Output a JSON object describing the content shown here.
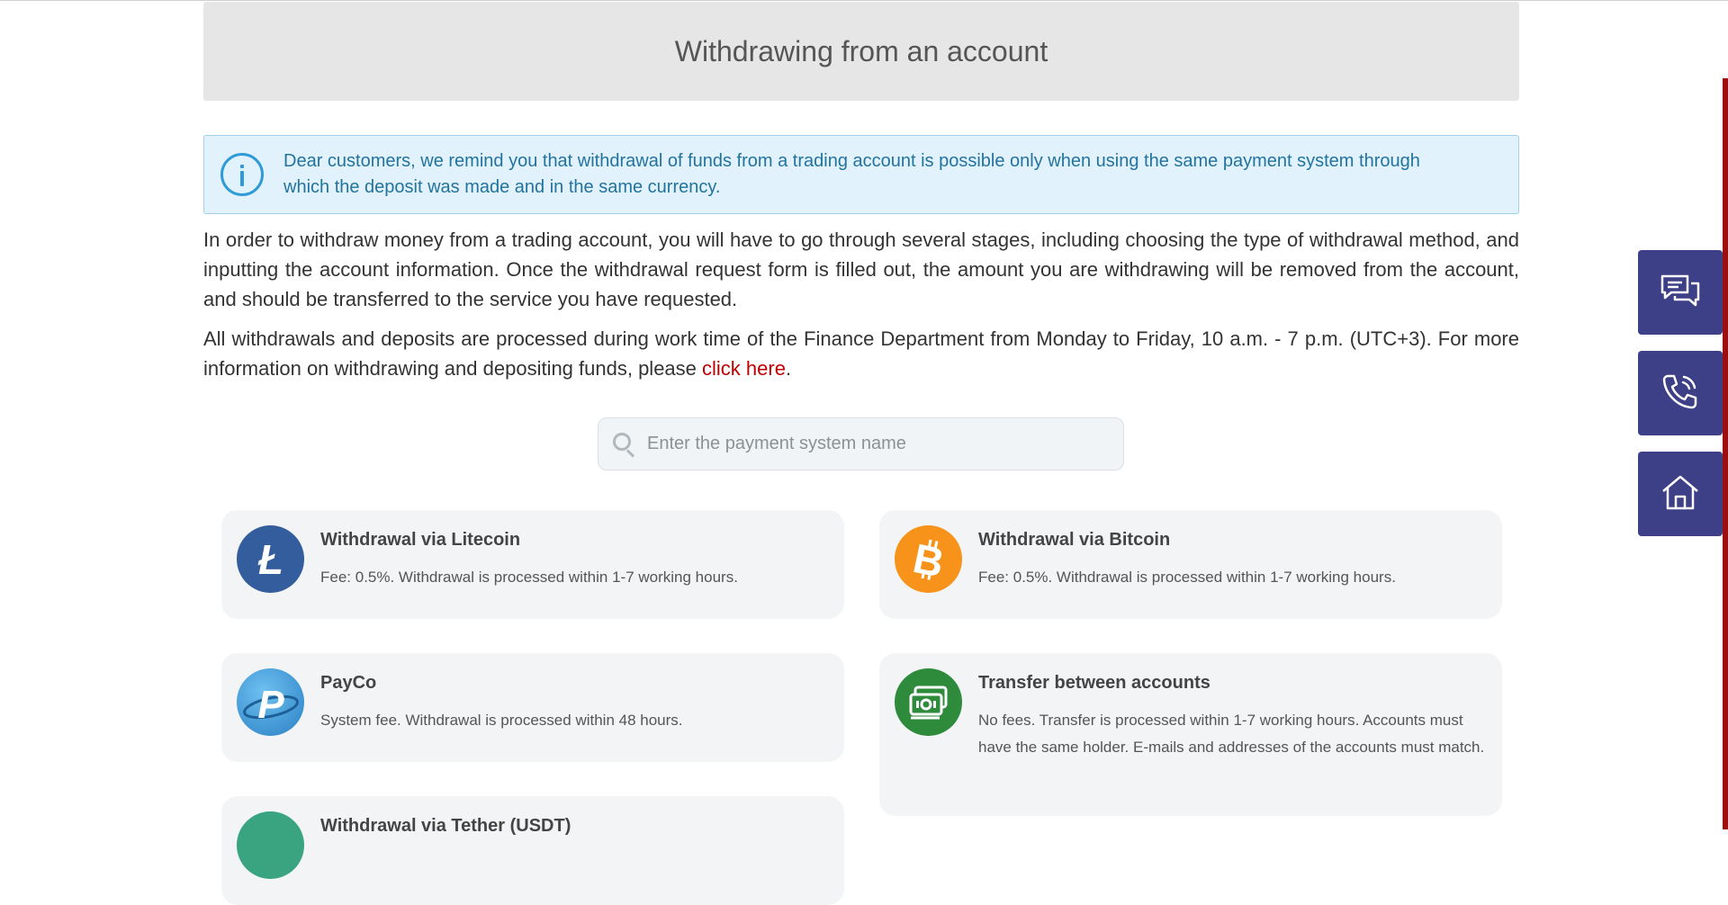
{
  "page_title": "Withdrawing from an account",
  "notice": "Dear customers, we remind you that withdrawal of funds from a trading account is possible only when using the same payment system through which the deposit was made and in the same currency.",
  "paragraph1": "In order to withdraw money from a trading account, you will have to go through several stages, including choosing the type of withdrawal method, and inputting the account information. Once the withdrawal request form is filled out, the amount you are withdrawing will be removed from the account, and should be transferred to the service you have requested.",
  "paragraph2": {
    "text": "All withdrawals and deposits are processed during work time of the Finance Department from Monday to Friday, 10 a.m. - 7 p.m. (UTC+3). For more information on withdrawing and depositing funds, please ",
    "link": "click here",
    "end": "."
  },
  "search": {
    "placeholder": "Enter the payment system name",
    "icon": "search-icon"
  },
  "methods": [
    {
      "title": "Withdrawal via Litecoin",
      "desc": "Fee: 0.5%. Withdrawal is processed within 1-7 working hours.",
      "icon": "litecoin-icon",
      "color": "#345d9d"
    },
    {
      "title": "Withdrawal via Bitcoin",
      "desc": "Fee: 0.5%. Withdrawal is processed within 1-7 working hours.",
      "icon": "bitcoin-icon",
      "color": "#f7931a"
    },
    {
      "title": "PayCo",
      "desc": "System fee. Withdrawal is processed within 48 hours.",
      "icon": "payco-icon",
      "color": "#3a8fd0"
    },
    {
      "title": "Transfer between accounts",
      "desc": "No fees. Transfer is processed within 1-7 working hours. Accounts must have the same holder. E-mails and addresses of the accounts must match.",
      "icon": "money-transfer-icon",
      "color": "#2e8b3b"
    },
    {
      "title": "Withdrawal via Tether (USDT)",
      "icon": "tether-icon",
      "color": "#3aa37f"
    }
  ],
  "side_buttons": [
    {
      "icon": "chat-icon"
    },
    {
      "icon": "phone-icon"
    },
    {
      "icon": "home-icon"
    }
  ],
  "colors": {
    "side_button": "#3d3f87",
    "link": "#c00000",
    "notice_bg": "#e1f2fc",
    "scrollbar": "#9b0f10"
  }
}
